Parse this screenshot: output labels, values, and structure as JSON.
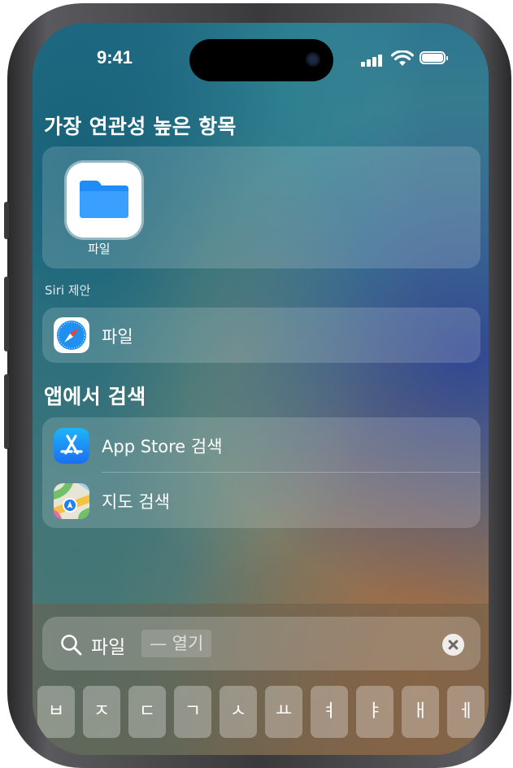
{
  "status_bar": {
    "time": "9:41"
  },
  "top_hit": {
    "heading": "가장 연관성 높은 항목",
    "app_label": "파일"
  },
  "siri": {
    "heading": "Siri 제안",
    "item_label": "파일"
  },
  "search_in_apps": {
    "heading": "앱에서 검색",
    "items": [
      {
        "label": "App Store 검색",
        "icon": "app-store-icon"
      },
      {
        "label": "지도 검색",
        "icon": "maps-icon"
      }
    ]
  },
  "search_bar": {
    "query": "파일",
    "suggestion": "— 열기"
  },
  "keyboard": {
    "keys": [
      "ㅂ",
      "ㅈ",
      "ㄷ",
      "ㄱ",
      "ㅅ",
      "ㅛ",
      "ㅕ",
      "ㅑ",
      "ㅐ",
      "ㅔ"
    ]
  },
  "colors": {
    "files_blue": "#1e8df7",
    "app_store_blue": "#1a8cf8"
  }
}
